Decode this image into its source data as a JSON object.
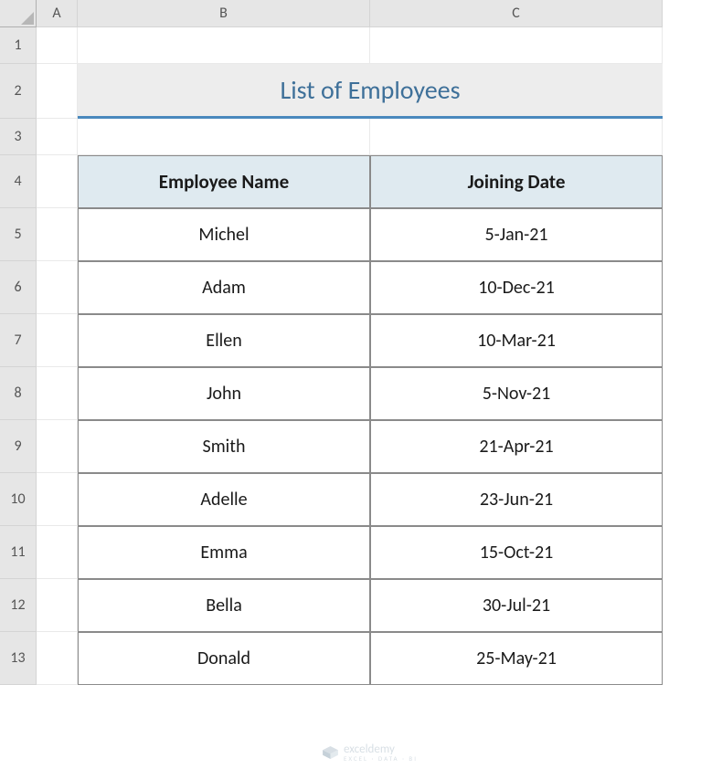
{
  "columns": [
    "",
    "A",
    "B",
    "C"
  ],
  "rows": [
    "1",
    "2",
    "3",
    "4",
    "5",
    "6",
    "7",
    "8",
    "9",
    "10",
    "11",
    "12",
    "13"
  ],
  "title": "List of Employees",
  "headers": {
    "name": "Employee Name",
    "date": "Joining Date"
  },
  "employees": [
    {
      "name": "Michel",
      "date": "5-Jan-21"
    },
    {
      "name": "Adam",
      "date": "10-Dec-21"
    },
    {
      "name": "Ellen",
      "date": "10-Mar-21"
    },
    {
      "name": "John",
      "date": "5-Nov-21"
    },
    {
      "name": "Smith",
      "date": "21-Apr-21"
    },
    {
      "name": "Adelle",
      "date": "23-Jun-21"
    },
    {
      "name": "Emma",
      "date": "15-Oct-21"
    },
    {
      "name": "Bella",
      "date": "30-Jul-21"
    },
    {
      "name": "Donald",
      "date": "25-May-21"
    }
  ],
  "watermark": {
    "brand": "exceldemy",
    "tag": "EXCEL · DATA · BI"
  }
}
